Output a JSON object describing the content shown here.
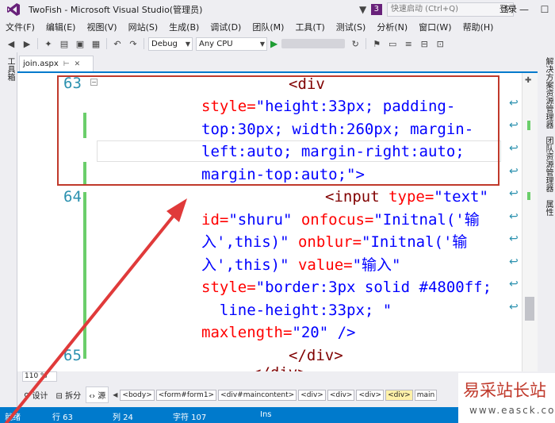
{
  "window": {
    "title": "TwoFish - Microsoft Visual Studio(管理员)",
    "notifications": "3",
    "quick_launch_placeholder": "快速启动 (Ctrl+Q)"
  },
  "menu": {
    "items": [
      "文件(F)",
      "编辑(E)",
      "视图(V)",
      "网站(S)",
      "生成(B)",
      "调试(D)",
      "团队(M)",
      "工具(T)",
      "测试(S)",
      "分析(N)",
      "窗口(W)",
      "帮助(H)"
    ],
    "login": "登录"
  },
  "toolbar": {
    "config": "Debug",
    "platform": "Any CPU"
  },
  "left_panel": {
    "toolbox": "工具箱"
  },
  "right_panel": {
    "solution_explorer": "解决方案资源管理器",
    "team_explorer": "团队资源管理器",
    "properties": "属性"
  },
  "document": {
    "tab_name": "join.aspx"
  },
  "editor": {
    "line_numbers": [
      "63",
      "64",
      "65"
    ],
    "lines": {
      "l1_tag": "<div",
      "l2_attr": "style=",
      "l2_val": "\"height:33px; padding-",
      "l3_val": "top:30px; width:260px; margin-",
      "l4_val": "left:auto; margin-right:auto;",
      "l5_val": "margin-top:auto;\"",
      "l5_close": ">",
      "l6_tag": "<input",
      "l6_attr": " type=",
      "l6_val": "\"text\"",
      "l7_attr1": "id=",
      "l7_val1": "\"shuru\"",
      "l7_attr2": " onfocus=",
      "l7_val2": "\"Initnal('输",
      "l8_val1": "入',this)\"",
      "l8_attr": " onblur=",
      "l8_val2": "\"Initnal('输",
      "l9_val1": "入',this)\"",
      "l9_attr": " value=",
      "l9_val2": "\"输入\"",
      "l10_attr": "style=",
      "l10_val": "\"border:3px solid #4800ff;",
      "l11_val": "  line-height:33px; \"",
      "l12_attr": "maxlength=",
      "l12_val": "\"20\"",
      "l12_close": " />",
      "l13_tag": "</div>",
      "l14_tag": "</div>"
    }
  },
  "zoom": "110 %",
  "bottom": {
    "view_design": "设计",
    "view_split": "拆分",
    "view_source": "源",
    "crumbs": [
      "<body>",
      "<form#form1>",
      "<div#maincontent>",
      "<div>",
      "<div>",
      "<div>",
      "<div>"
    ],
    "crumb_overflow": "main"
  },
  "status": {
    "ready": "就绪",
    "line": "行 63",
    "col": "列 24",
    "char": "字符 107",
    "mode": "Ins"
  },
  "watermark": {
    "cn": "易采站长站",
    "url": "www.easck.com"
  },
  "colors": {
    "accent": "#007acc",
    "annotation": "#c0392b",
    "change_bar": "#6bce6b"
  }
}
